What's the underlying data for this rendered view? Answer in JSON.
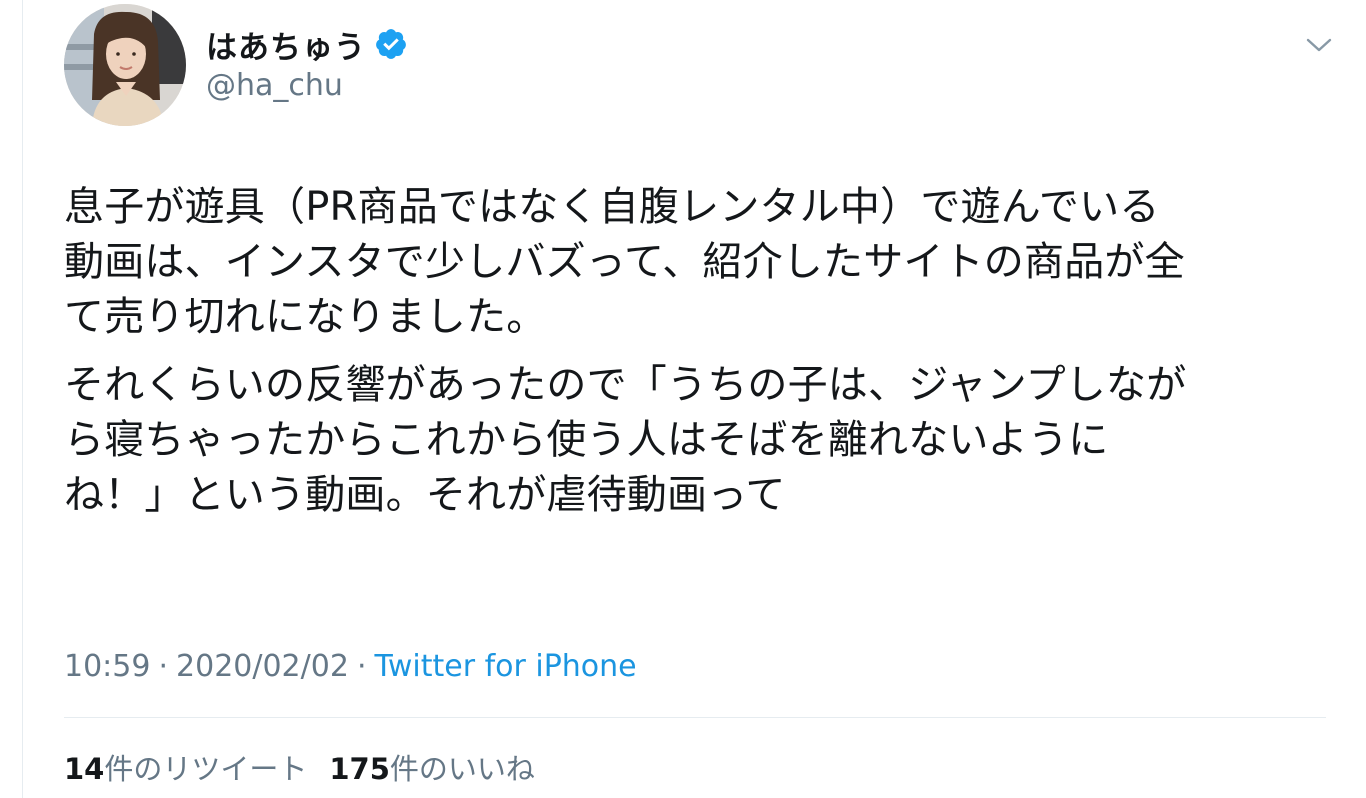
{
  "user": {
    "display_name": "はあちゅう",
    "handle": "@ha_chu",
    "verified": true,
    "verified_icon": "verified-badge-icon",
    "verified_color": "#1da1f2"
  },
  "menu": {
    "caret_icon": "chevron-down-icon"
  },
  "tweet": {
    "paragraphs": [
      {
        "lines": [
          "息子が遊具（PR商品ではなく自腹レンタル中）で遊んでいる",
          "動画は、インスタで少しバズって、紹介したサイトの商品が全",
          "て売り切れになりました。"
        ]
      },
      {
        "lines": [
          "それくらいの反響があったので「うちの子は、ジャンプしなが",
          "ら寝ちゃったからこれから使う人はそばを離れないように",
          "ね！」という動画。それが虐待動画って"
        ]
      }
    ]
  },
  "meta": {
    "time": "10:59",
    "separator1": "·",
    "date": "2020/02/02",
    "separator2": "·",
    "source": "Twitter for iPhone",
    "source_color": "#1b95e0"
  },
  "stats": {
    "retweets_count": "14",
    "retweets_label": "件のリツイート",
    "likes_count": "175",
    "likes_label": "件のいいね"
  }
}
